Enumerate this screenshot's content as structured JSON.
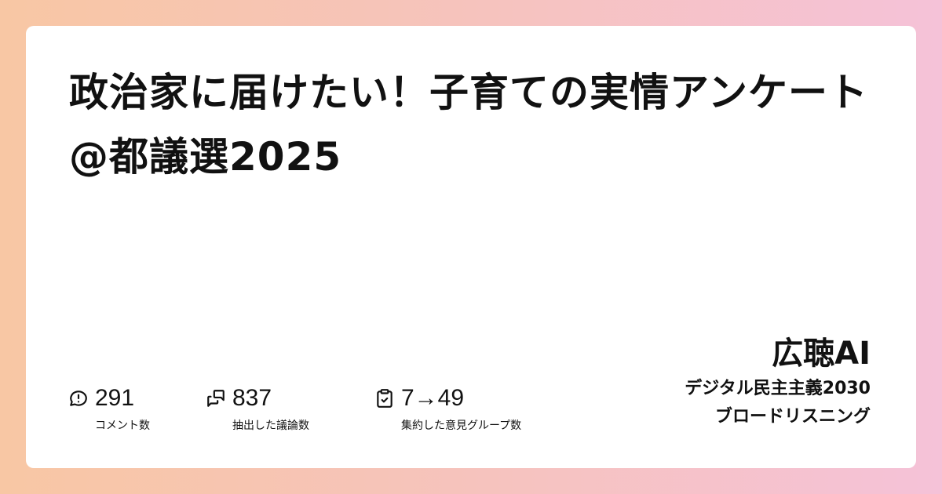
{
  "title": "政治家に届けたい！子育ての実情アンケート@都議選2025",
  "stats": [
    {
      "icon": "comment-alert-icon",
      "value": "291",
      "label": "コメント数"
    },
    {
      "icon": "messages-icon",
      "value": "837",
      "label": "抽出した議論数"
    },
    {
      "icon": "clipboard-check-icon",
      "value": "7→49",
      "label": "集約した意見グループ数"
    }
  ],
  "brand": {
    "name": "広聴AI",
    "line1": "デジタル民主主義2030",
    "line2": "ブロードリスニング"
  }
}
